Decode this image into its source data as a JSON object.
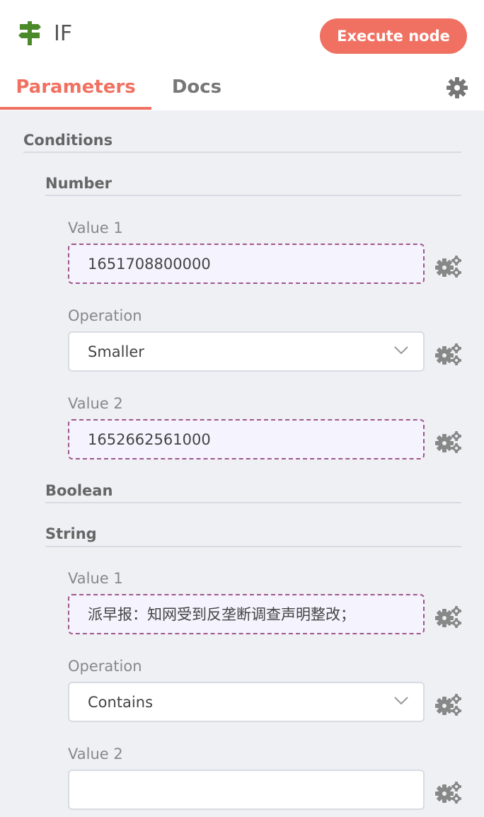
{
  "header": {
    "node_title": "IF",
    "execute_label": "Execute node",
    "icon": "signpost-icon"
  },
  "tabs": [
    {
      "label": "Parameters",
      "active": true
    },
    {
      "label": "Docs",
      "active": false
    }
  ],
  "settings_icon": "gear-icon",
  "conditions": {
    "title": "Conditions",
    "number": {
      "title": "Number",
      "value1_label": "Value 1",
      "value1": "1651708800000",
      "operation_label": "Operation",
      "operation": "Smaller",
      "value2_label": "Value 2",
      "value2": "1652662561000"
    },
    "boolean": {
      "title": "Boolean"
    },
    "string": {
      "title": "String",
      "value1_label": "Value 1",
      "value1": "派早报：知网受到反垄断调查声明整改；",
      "operation_label": "Operation",
      "operation": "Contains",
      "value2_label": "Value 2",
      "value2": ""
    }
  },
  "colors": {
    "accent": "#f07162",
    "expression_border": "#a0568a",
    "expression_bg": "#f5f3fd",
    "icon_green": "#4a8a2a"
  }
}
